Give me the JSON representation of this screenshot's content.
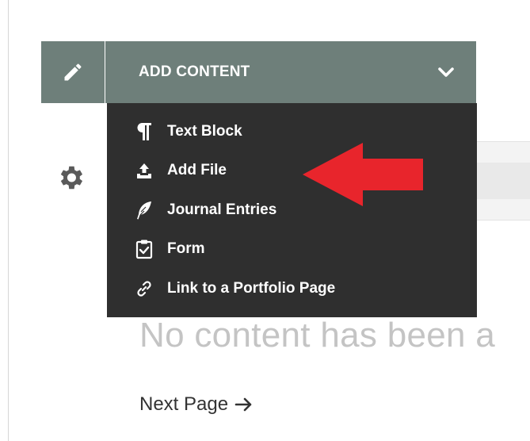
{
  "header": {
    "edit_icon": "pencil-icon",
    "add_content_label": "ADD CONTENT",
    "chevron_icon": "chevron-down-icon"
  },
  "menu": {
    "items": [
      {
        "label": "Text Block",
        "icon": "paragraph-icon"
      },
      {
        "label": "Add File",
        "icon": "upload-icon"
      },
      {
        "label": "Journal Entries",
        "icon": "feather-icon"
      },
      {
        "label": "Form",
        "icon": "clipboard-check-icon"
      },
      {
        "label": "Link to a Portfolio Page",
        "icon": "link-icon"
      }
    ]
  },
  "main": {
    "empty_message": "No content has been a",
    "next_page_label": "Next Page"
  },
  "colors": {
    "header_bg": "#6e7f7a",
    "menu_bg": "#2f2f2f",
    "annotation_arrow": "#e8252c",
    "empty_text": "#c4c4c4"
  }
}
